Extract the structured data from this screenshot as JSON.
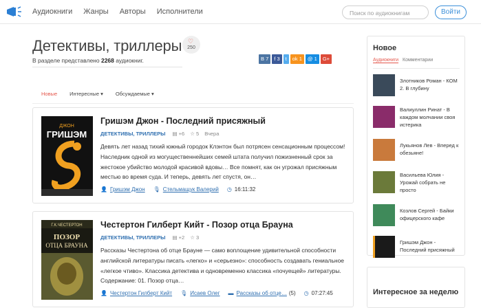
{
  "nav": {
    "items": [
      "Аудиокниги",
      "Жанры",
      "Авторы",
      "Исполнители"
    ],
    "search_placeholder": "Поиск по аудиокнигам",
    "login": "Войти"
  },
  "page": {
    "title": "Детективы, триллеры",
    "likes": "250",
    "subtitle_prefix": "В разделе представлено",
    "count": "2268",
    "subtitle_suffix": "аудиокниг."
  },
  "share": [
    {
      "label": "В",
      "count": "7",
      "color": "#4c75a3"
    },
    {
      "label": "f",
      "count": "3",
      "color": "#3b5998"
    },
    {
      "label": "t",
      "count": "",
      "color": "#55acee"
    },
    {
      "label": "ok",
      "count": "1",
      "color": "#f7931e"
    },
    {
      "label": "@",
      "count": "1",
      "color": "#168de2"
    },
    {
      "label": "G+",
      "count": "",
      "color": "#dd4b39"
    }
  ],
  "tabs": [
    "Новые",
    "Интересные ▾",
    "Обсуждаемые ▾"
  ],
  "books": [
    {
      "title": "Гришэм Джон - Последний присяжный",
      "genre": "ДЕТЕКТИВЫ, ТРИЛЛЕРЫ",
      "plus": "+6",
      "stars": "5",
      "date": "Вчера",
      "desc": "Девять лет назад тихий южный городок Клэнтон был потрясен сенсационным процессом! Наследник одной из могущественнейших семей штата получил пожизненный срок за жестокое убийство молодой красивой вдовы… Все помнят, как он угрожал присяжным местью во время суда. И теперь, девять лет спустя, он…",
      "author": "Гришэм Джон",
      "reader": "Стельмащук Валерий",
      "series": "",
      "series_count": "",
      "duration": "16:11:32",
      "cover_top": "ГРИШЭМ",
      "cover_sub": "ДЖОН"
    },
    {
      "title": "Честертон Гилберт Кийт - Позор отца Брауна",
      "genre": "ДЕТЕКТИВЫ, ТРИЛЛЕРЫ",
      "plus": "+2",
      "stars": "3",
      "date": "",
      "desc": "Рассказы Честертона об отце Брауне — само воплощение удивительной способности английской литературы писать «легко» и «серьезно»: способность создавать гениальное «легкое чтиво». Классика детектива и одновременно классика «почуещей» литературы. Содержание: 01. Позор отца…",
      "author": "Честертон Гилберт Кийт",
      "reader": "Исаев Олег",
      "series": "Рассказы об отце…",
      "series_count": "(5)",
      "duration": "07:27:45",
      "cover_top": "Г.К.ЧЕСТЕРТОН",
      "cover_sub": "ПОЗОР ОТЦА БРАУНА"
    }
  ],
  "sidebar": {
    "title": "Новое",
    "tab_active": "Аудиокниги",
    "tab_other": "Комментарии",
    "items": [
      {
        "text": "Злотников Роман - КОМ 2. В глубину",
        "color": "#3a4a5a"
      },
      {
        "text": "Валиуллин Ринат - В каждом молчании своя истерика",
        "color": "#8a2c6a"
      },
      {
        "text": "Лукьянов Лев - Вперед к обезьяне!",
        "color": "#c97a3c"
      },
      {
        "text": "Васильева Юлия - Урожай собрать не просто",
        "color": "#6b7a3a"
      },
      {
        "text": "Козлов Сергей - Байки офицерского кафе",
        "color": "#3f8a5a"
      },
      {
        "text": "Гришэм Джон - Последний присяжный",
        "color": "#1a1a1a"
      }
    ]
  },
  "sidebar2": {
    "title": "Интересное за неделю"
  }
}
